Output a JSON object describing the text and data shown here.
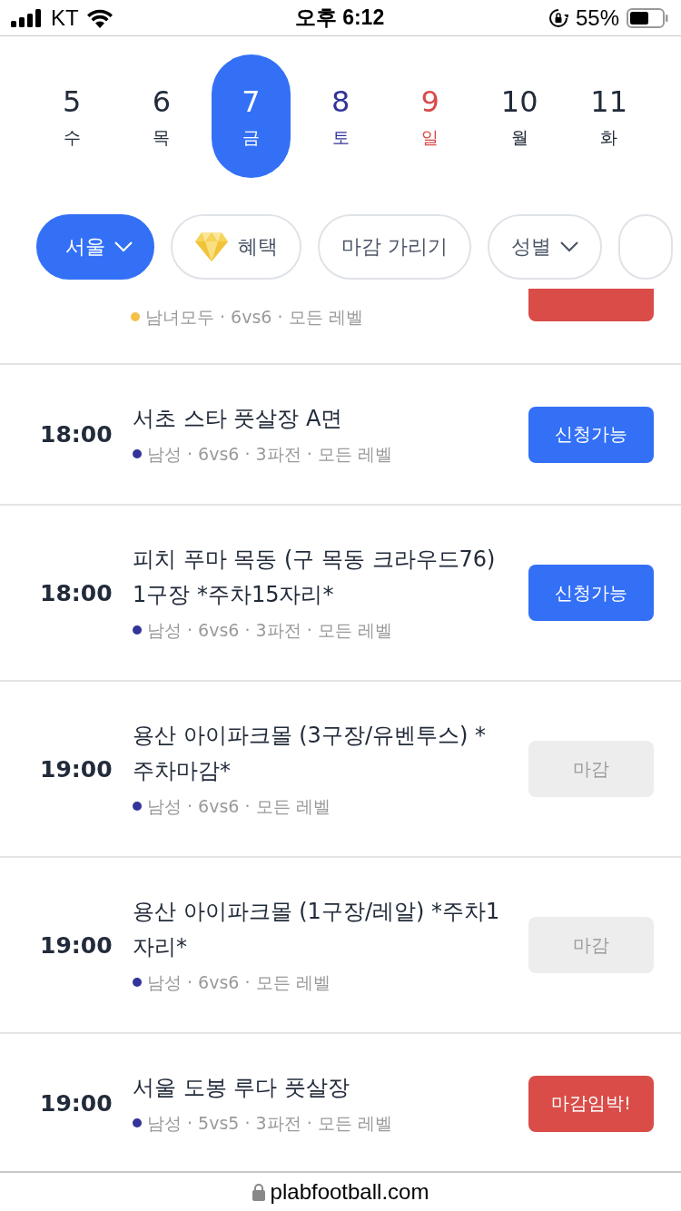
{
  "status_bar": {
    "carrier": "KT",
    "time": "오후 6:12",
    "battery": "55%"
  },
  "dates": [
    {
      "day": "5",
      "weekday": "수",
      "selected": false,
      "color": "#222b3a"
    },
    {
      "day": "6",
      "weekday": "목",
      "selected": false,
      "color": "#222b3a"
    },
    {
      "day": "7",
      "weekday": "금",
      "selected": true
    },
    {
      "day": "8",
      "weekday": "토",
      "selected": false,
      "color": "#33339a"
    },
    {
      "day": "9",
      "weekday": "일",
      "selected": false,
      "color": "#d94a4a"
    },
    {
      "day": "10",
      "weekday": "월",
      "selected": false,
      "color": "#222b3a"
    },
    {
      "day": "11",
      "weekday": "화",
      "selected": false,
      "color": "#222b3a"
    }
  ],
  "filters": [
    {
      "label": "서울",
      "selected": true,
      "dropdown": true,
      "icon": false
    },
    {
      "label": "혜택",
      "selected": false,
      "dropdown": false,
      "icon": true
    },
    {
      "label": "마감 가리기",
      "selected": false,
      "dropdown": false,
      "icon": false
    },
    {
      "label": "성별",
      "selected": false,
      "dropdown": true,
      "icon": false
    }
  ],
  "matches": [
    {
      "meta": "남녀모두 · 6vs6 · 모든 레벨",
      "color": "#f5c04a",
      "button": {
        "kind": "closing"
      }
    },
    {
      "time": "18:00",
      "title": "서초 스타 풋살장 A면",
      "meta": "남성 · 6vs6 · 3파전 · 모든 레벨",
      "color": "#33339a",
      "button": {
        "kind": "open",
        "label": "신청가능"
      }
    },
    {
      "time": "18:00",
      "title": "피치 푸마 목동 (구 목동 크라우드76) 1구장 *주차15자리*",
      "meta": "남성 · 6vs6 · 3파전 · 모든 레벨",
      "color": "#33339a",
      "button": {
        "kind": "open",
        "label": "신청가능"
      }
    },
    {
      "time": "19:00",
      "title": "용산 아이파크몰 (3구장/유벤투스) *주차마감*",
      "meta": "남성 · 6vs6 · 모든 레벨",
      "color": "#33339a",
      "button": {
        "kind": "closed",
        "label": "마감"
      }
    },
    {
      "time": "19:00",
      "title": "용산 아이파크몰 (1구장/레알) *주차1자리*",
      "meta": "남성 · 6vs6 · 모든 레벨",
      "color": "#33339a",
      "button": {
        "kind": "closed",
        "label": "마감"
      }
    },
    {
      "time": "19:00",
      "title": "서울 도봉 루다 풋살장",
      "meta": "남성 · 5vs5 · 3파전 · 모든 레벨",
      "color": "#33339a",
      "button": {
        "kind": "closing",
        "label": "마감임박!"
      }
    }
  ],
  "url_bar": {
    "url": "plabfootball.com"
  }
}
